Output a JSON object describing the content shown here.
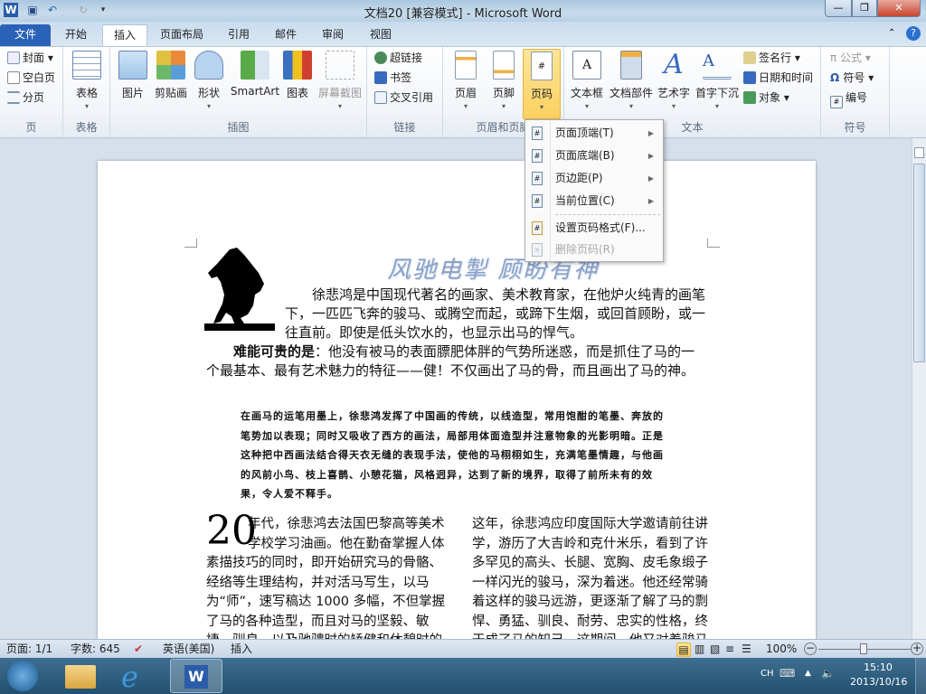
{
  "window": {
    "title": "文档20 [兼容模式] - Microsoft Word",
    "minimize": "—",
    "restore": "❐",
    "close": "✕"
  },
  "tabs": [
    {
      "label": "文件"
    },
    {
      "label": "开始"
    },
    {
      "label": "插入"
    },
    {
      "label": "页面布局"
    },
    {
      "label": "引用"
    },
    {
      "label": "邮件"
    },
    {
      "label": "审阅"
    },
    {
      "label": "视图"
    }
  ],
  "ribbon": {
    "pages": {
      "label": "页",
      "items": [
        "封面",
        "空白页",
        "分页"
      ]
    },
    "table": {
      "label": "表格",
      "button": "表格"
    },
    "illustrations": {
      "label": "插图",
      "buttons": [
        "图片",
        "剪贴画",
        "形状",
        "SmartArt",
        "图表",
        "屏幕截图"
      ]
    },
    "links": {
      "label": "链接",
      "items": [
        "超链接",
        "书签",
        "交叉引用"
      ]
    },
    "header_footer": {
      "label": "页眉和页脚",
      "buttons": [
        "页眉",
        "页脚",
        "页码"
      ]
    },
    "text": {
      "label": "文本",
      "buttons": [
        "文本框",
        "文档部件",
        "艺术字",
        "首字下沉"
      ],
      "items": [
        "签名行",
        "日期和时间",
        "对象"
      ]
    },
    "symbols": {
      "label": "符号",
      "items": [
        "公式",
        "符号",
        "编号"
      ]
    }
  },
  "page_number_menu": {
    "items": [
      {
        "label": "页面顶端(T)",
        "submenu": true
      },
      {
        "label": "页面底端(B)",
        "submenu": true
      },
      {
        "label": "页边距(P)",
        "submenu": true
      },
      {
        "label": "当前位置(C)",
        "submenu": true
      },
      {
        "label": "设置页码格式(F)...",
        "submenu": false
      },
      {
        "label": "删除页码(R)",
        "submenu": false,
        "disabled": true
      }
    ]
  },
  "document": {
    "wordart": "风驰电掣 顾盼有神",
    "p1": "徐悲鸿是中国现代著名的画家、美术教育家，在他炉火纯青的画笔下，一匹匹飞奔的骏马、或腾空而起，或蹄下生烟，或回首顾盼，或一往直前。即使是低头饮水的，也显示出马的悍气。",
    "p2_bold": "难能可贵的是",
    "p2": "：他没有被马的表面膘肥体胖的气势所迷惑，而是抓住了马的一个最基本、最有艺术魅力的特征——健！不仅画出了马的骨，而且画出了马的神。",
    "quote": "在画马的运笔用墨上，徐悲鸿发挥了中国画的传统，以线造型，常用饱酣的笔墨、奔放的笔势加以表现；同时又吸收了西方的画法，局部用体面造型并注意物象的光影明暗。正是这种把中西画法结合得天衣无缝的表现手法，使他的马栩栩如生，充满笔墨情趣，与他画的风前小鸟、枝上喜鹊、小憩花猫，风格迥异，达到了新的境界，取得了前所未有的效果，令人爱不释手。",
    "dropcap": "20",
    "col1": "年代，徐悲鸿去法国巴黎高等美术学校学习油画。他在勤奋掌握人体素描技巧的同时，即开始研究马的骨骼、经络等生理结构，并对活马写生，以马为“师”，速写稿达 1000 多幅，不但掌握了马的各种造型，而且对马的坚毅、敏捷、驯良，以及驰骋时的矫健和休憩时的安静",
    "col2": "这年，徐悲鸿应印度国际大学邀请前往讲学，游历了大吉岭和克什米乐，看到了许多罕见的高头、长腿、宽胸、皮毛象缎子一样闪光的骏马，深为着迷。他还经常骑着这样的骏马远游，更逐渐了解了马的剽悍、勇猛、驯良、耐劳、忠实的性格，终于成了马的知己，这期间，他又对着骏马"
  },
  "status": {
    "page": "页面: 1/1",
    "words": "字数: 645",
    "language": "英语(美国)",
    "mode": "插入",
    "zoom": "100%",
    "zoom_percent": 100
  },
  "taskbar": {
    "lang": "CH",
    "time": "15:10",
    "date": "2013/10/16"
  },
  "colors": {
    "file_tab": "#2a62b8",
    "highlight": "#fbd060",
    "page_bg": "#d6dfea"
  }
}
